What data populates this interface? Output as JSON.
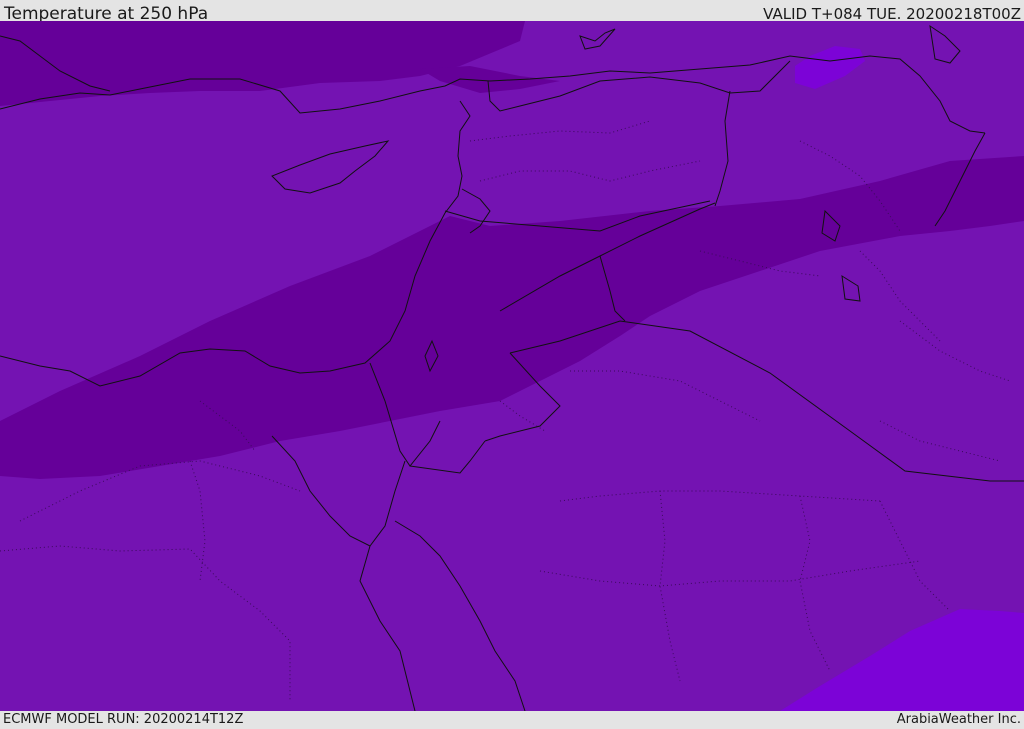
{
  "header": {
    "title": "Temperature at 250 hPa",
    "valid": "VALID T+084 TUE. 20200218T00Z"
  },
  "footer": {
    "model_run": "ECMWF MODEL RUN: 20200214T12Z",
    "credit": "ArabiaWeather Inc."
  },
  "colors": {
    "base": "#7413b2",
    "cold_band": "#650099",
    "warm": "#7c03d7",
    "border": "#111111",
    "admin": "#3a0a5a"
  }
}
